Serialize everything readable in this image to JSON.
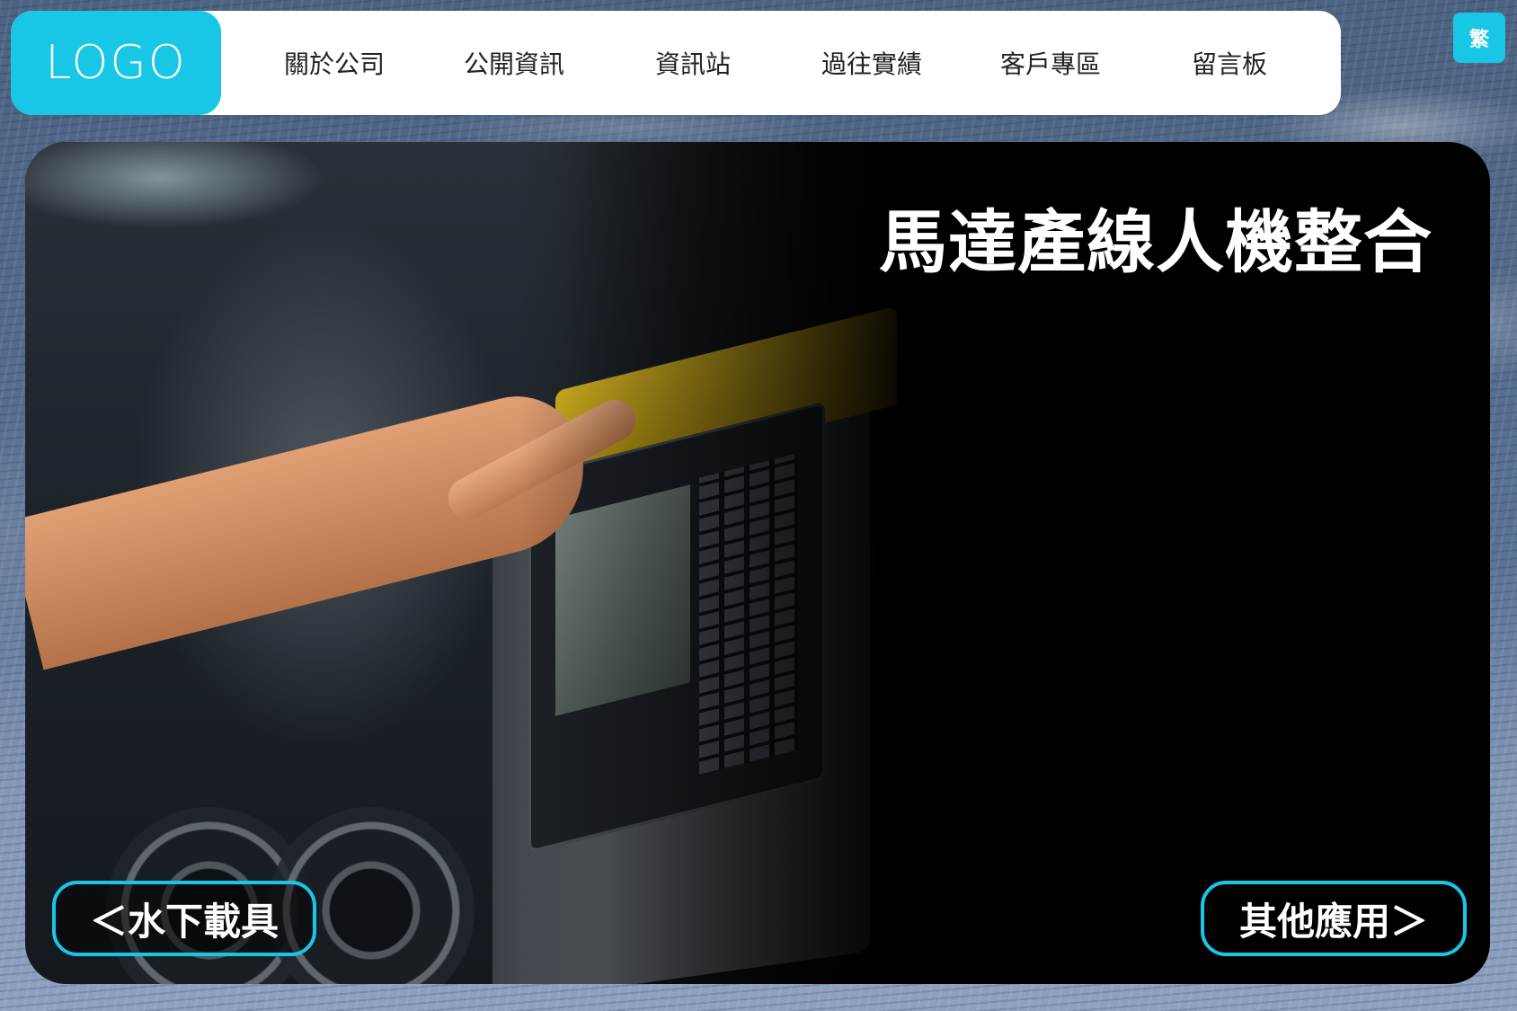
{
  "header": {
    "logo_text": "LOGO",
    "nav_items": [
      {
        "label": "關於公司"
      },
      {
        "label": "公開資訊"
      },
      {
        "label": "資訊站"
      },
      {
        "label": "過往實績"
      },
      {
        "label": "客戶專區"
      },
      {
        "label": "留言板"
      }
    ]
  },
  "language_toggle": {
    "label": "繁"
  },
  "hero": {
    "title": "馬達產線人機整合",
    "prev_button": "＜水下載具",
    "next_button": "其他應用＞"
  },
  "colors": {
    "accent": "#18c6e6",
    "background": "#5a7295",
    "hero_bg": "#000000"
  }
}
